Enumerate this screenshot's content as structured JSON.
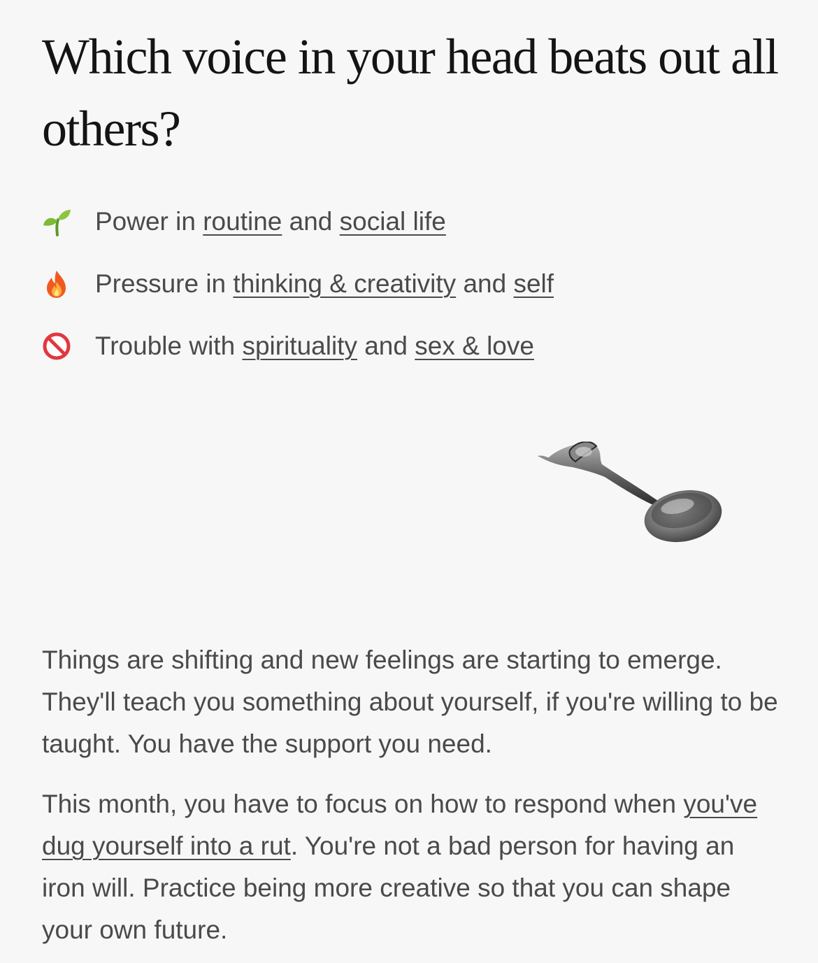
{
  "title": "Which voice in your head beats out all others?",
  "influences": [
    {
      "icon": "seedling-icon",
      "prefix": "Power in",
      "link1": "routine",
      "joiner": "and",
      "link2": "social life"
    },
    {
      "icon": "fire-icon",
      "prefix": "Pressure in",
      "link1": "thinking & creativity",
      "joiner": "and",
      "link2": "self"
    },
    {
      "icon": "prohibited-icon",
      "prefix": "Trouble with",
      "link1": "spirituality",
      "joiner": "and",
      "link2": "sex & love"
    }
  ],
  "illustration": "spoon-illustration",
  "paragraph1": "Things are shifting and new feelings are starting to emerge. They'll teach you something about yourself, if you're willing to be taught. You have the support you need.",
  "paragraph2": {
    "before": "This month, you have to focus on how to respond when ",
    "link": "you've dug yourself into a rut",
    "after": ". You're not a bad person for having an iron will. Practice being more creative so that you can shape your own future."
  },
  "colors": {
    "background": "#f7f7f7",
    "title": "#141414",
    "text": "#4a4a4a"
  }
}
